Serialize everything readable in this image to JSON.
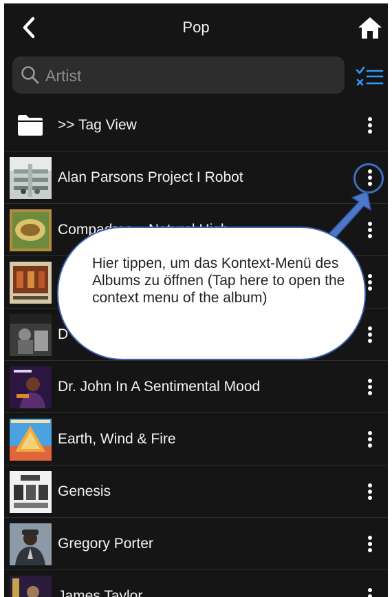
{
  "header": {
    "title": "Pop",
    "back_icon": "chevron-left-icon",
    "home_icon": "home-icon"
  },
  "search": {
    "placeholder": "Artist",
    "value": ""
  },
  "filter_icon": "checklist-filter-icon",
  "colors": {
    "background": "#151515",
    "accent": "#2f9bff",
    "callout_border": "#3b64b5"
  },
  "list": {
    "items": [
      {
        "label": ">> Tag View",
        "type": "folder"
      },
      {
        "label": "Alan Parsons Project I Robot",
        "type": "album"
      },
      {
        "label": "Compadres – Natural High",
        "type": "album"
      },
      {
        "label": "",
        "type": "album"
      },
      {
        "label": "D",
        "type": "album"
      },
      {
        "label": "Dr. John In A Sentimental Mood",
        "type": "album"
      },
      {
        "label": "Earth, Wind & Fire",
        "type": "album"
      },
      {
        "label": "Genesis",
        "type": "album"
      },
      {
        "label": "Gregory Porter",
        "type": "album"
      },
      {
        "label": "James Taylor",
        "type": "album"
      }
    ]
  },
  "callout": {
    "text": "Hier tippen, um das Kontext-Menü des Albums zu öffnen (Tap here to open the context menu of the album)"
  }
}
